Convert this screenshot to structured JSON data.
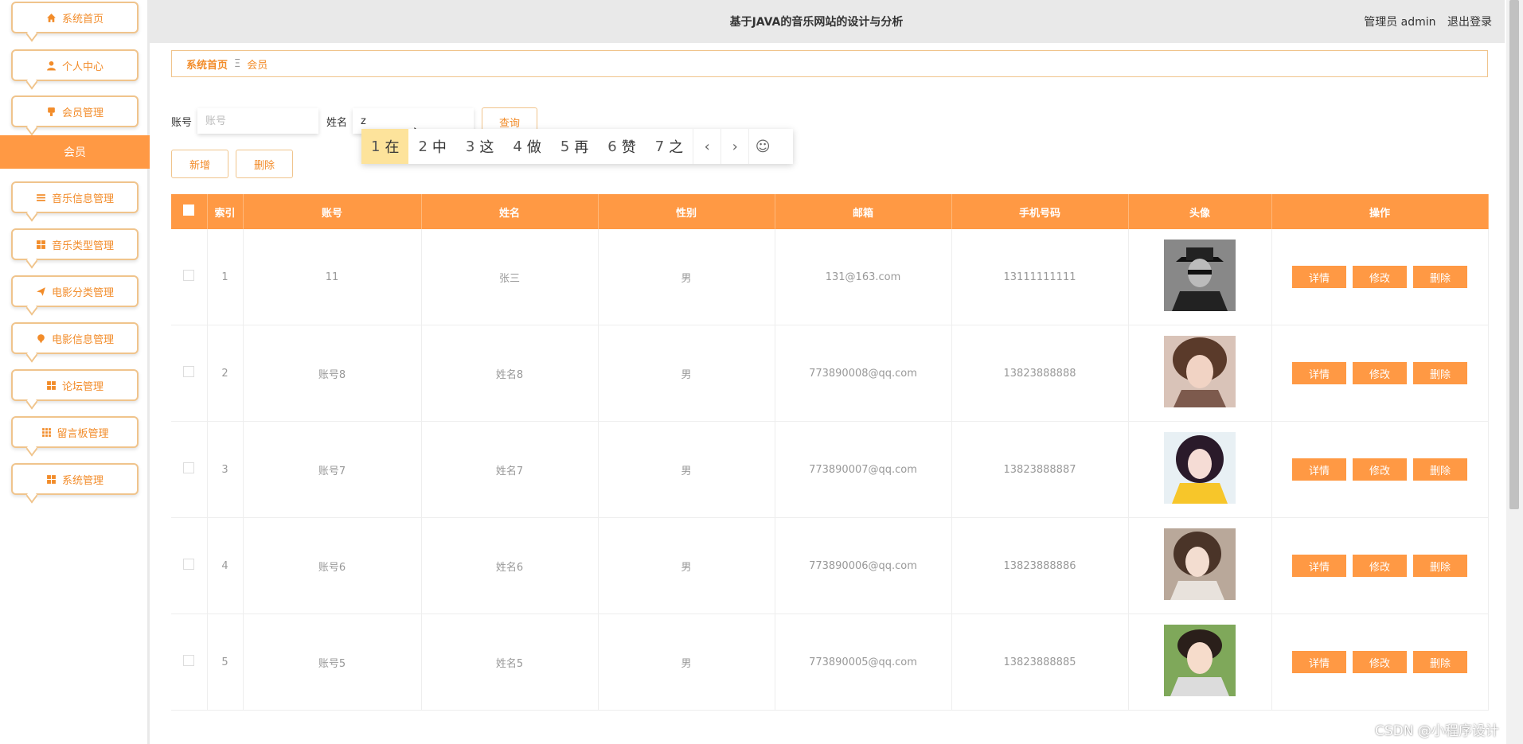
{
  "header": {
    "title": "基于JAVA的音乐网站的设计与分析",
    "user": "管理员 admin",
    "logout": "退出登录"
  },
  "sidebar": {
    "items": [
      {
        "label": "系统首页",
        "icon": "home-icon"
      },
      {
        "label": "个人中心",
        "icon": "user-icon"
      },
      {
        "label": "会员管理",
        "icon": "member-icon"
      },
      {
        "label": "音乐信息管理",
        "icon": "list-icon"
      },
      {
        "label": "音乐类型管理",
        "icon": "grid-icon"
      },
      {
        "label": "电影分类管理",
        "icon": "send-icon"
      },
      {
        "label": "电影信息管理",
        "icon": "pin-icon"
      },
      {
        "label": "论坛管理",
        "icon": "grid-icon"
      },
      {
        "label": "留言板管理",
        "icon": "apps-icon"
      },
      {
        "label": "系统管理",
        "icon": "grid-icon"
      }
    ],
    "active_sub": "会员"
  },
  "breadcrumb": {
    "home": "系统首页",
    "separator": "Ξ",
    "current": "会员"
  },
  "search": {
    "account_label": "账号",
    "account_placeholder": "账号",
    "name_label": "姓名",
    "name_value": "z",
    "query_button": "查询",
    "add_button": "新增",
    "delete_button": "删除"
  },
  "ime": {
    "candidates": [
      {
        "num": "1",
        "char": "在"
      },
      {
        "num": "2",
        "char": "中"
      },
      {
        "num": "3",
        "char": "这"
      },
      {
        "num": "4",
        "char": "做"
      },
      {
        "num": "5",
        "char": "再"
      },
      {
        "num": "6",
        "char": "赞"
      },
      {
        "num": "7",
        "char": "之"
      }
    ],
    "prev": "‹",
    "next": "›",
    "emoji": "☺"
  },
  "table": {
    "headers": [
      "索引",
      "账号",
      "姓名",
      "性别",
      "邮箱",
      "手机号码",
      "头像",
      "操作"
    ],
    "actions": {
      "detail": "详情",
      "edit": "修改",
      "delete": "删除"
    },
    "rows": [
      {
        "index": "1",
        "account": "11",
        "name": "张三",
        "gender": "男",
        "email": "131@163.com",
        "phone": "13111111111"
      },
      {
        "index": "2",
        "account": "账号8",
        "name": "姓名8",
        "gender": "男",
        "email": "773890008@qq.com",
        "phone": "13823888888"
      },
      {
        "index": "3",
        "account": "账号7",
        "name": "姓名7",
        "gender": "男",
        "email": "773890007@qq.com",
        "phone": "13823888887"
      },
      {
        "index": "4",
        "account": "账号6",
        "name": "姓名6",
        "gender": "男",
        "email": "773890006@qq.com",
        "phone": "13823888886"
      },
      {
        "index": "5",
        "account": "账号5",
        "name": "姓名5",
        "gender": "男",
        "email": "773890005@qq.com",
        "phone": "13823888885"
      }
    ]
  },
  "watermark": "CSDN @小程序设计",
  "colors": {
    "accent": "#ff9944",
    "border": "#f0c48c",
    "text_accent": "#f28c2a"
  }
}
